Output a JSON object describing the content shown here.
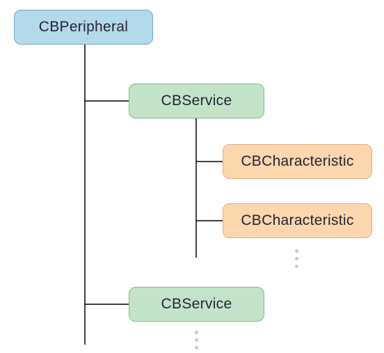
{
  "nodes": {
    "peripheral": "CBPeripheral",
    "service1": "CBService",
    "char1": "CBCharacteristic",
    "char2": "CBCharacteristic",
    "service2": "CBService"
  }
}
